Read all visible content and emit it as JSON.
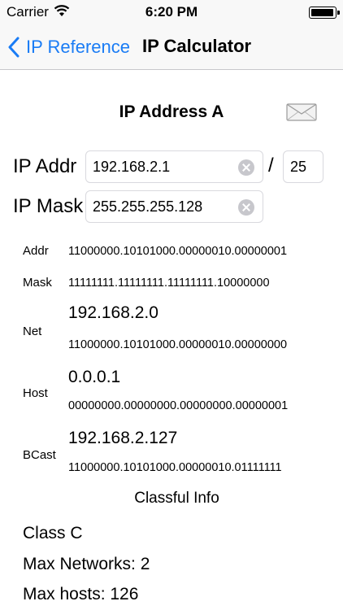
{
  "status_bar": {
    "carrier": "Carrier",
    "time": "6:20 PM",
    "battery_level": 1.0
  },
  "nav": {
    "back_label": "IP Reference",
    "title": "IP Calculator",
    "accent_color": "#1a7cf5"
  },
  "section": {
    "title": "IP Address A",
    "mail_icon": "mail-icon"
  },
  "inputs": {
    "ip_label": "IP Addr",
    "ip_value": "192.168.2.1",
    "slash": "/",
    "prefix_value": "25",
    "mask_label": "IP Mask",
    "mask_value": "255.255.255.128"
  },
  "results": {
    "addr_label": "Addr",
    "addr_binary": "11000000.10101000.00000010.00000001",
    "mask_label": "Mask",
    "mask_binary": "11111111.11111111.11111111.10000000",
    "net_label": "Net",
    "net_value": "192.168.2.0",
    "net_binary": "11000000.10101000.00000010.00000000",
    "host_label": "Host",
    "host_value": "0.0.0.1",
    "host_binary": "00000000.00000000.00000000.00000001",
    "bcast_label": "BCast",
    "bcast_value": "192.168.2.127",
    "bcast_binary": "11000000.10101000.00000010.01111111"
  },
  "classful": {
    "title": "Classful Info",
    "class": "Class C",
    "max_networks": "Max Networks: 2",
    "max_hosts": "Max hosts: 126"
  }
}
